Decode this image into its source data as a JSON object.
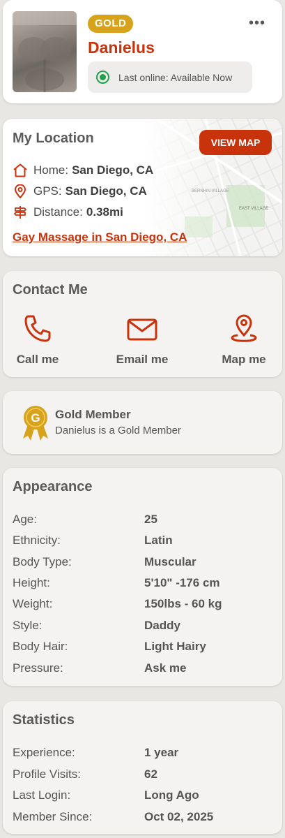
{
  "profile": {
    "badge": "GOLD",
    "name": "Danielus",
    "more": "•••",
    "status": "Last online: Available Now"
  },
  "location": {
    "title": "My Location",
    "view_map": "VIEW MAP",
    "home_label": "Home:",
    "home_value": "San Diego, CA",
    "gps_label": "GPS:",
    "gps_value": "San Diego, CA",
    "distance_label": "Distance:",
    "distance_value": "0.38mi",
    "link": "Gay Massage in San Diego, CA",
    "map_labels": [
      "EAST VILLAGE",
      "BERNHIN VILLAGE"
    ]
  },
  "contact": {
    "title": "Contact Me",
    "call": "Call me",
    "email": "Email me",
    "map": "Map me"
  },
  "gold_member": {
    "title": "Gold Member",
    "subtitle": "Danielus is a Gold Member",
    "medal_letter": "G"
  },
  "appearance": {
    "title": "Appearance",
    "rows": [
      {
        "label": "Age:",
        "value": "25"
      },
      {
        "label": "Ethnicity:",
        "value": "Latin"
      },
      {
        "label": "Body Type:",
        "value": "Muscular"
      },
      {
        "label": "Height:",
        "value": "5'10\" -176 cm"
      },
      {
        "label": "Weight:",
        "value": "150lbs - 60 kg"
      },
      {
        "label": "Style:",
        "value": "Daddy"
      },
      {
        "label": "Body Hair:",
        "value": "Light Hairy"
      },
      {
        "label": "Pressure:",
        "value": "Ask me"
      }
    ]
  },
  "statistics": {
    "title": "Statistics",
    "rows": [
      {
        "label": "Experience:",
        "value": "1 year"
      },
      {
        "label": "Profile Visits:",
        "value": "62"
      },
      {
        "label": "Last Login:",
        "value": "Long Ago"
      },
      {
        "label": "Member Since:",
        "value": "Oct 02, 2025"
      }
    ]
  },
  "colors": {
    "accent": "#c8330b",
    "gold": "#d7a21c",
    "online": "#22a04a",
    "background": "#e9e7e3"
  }
}
